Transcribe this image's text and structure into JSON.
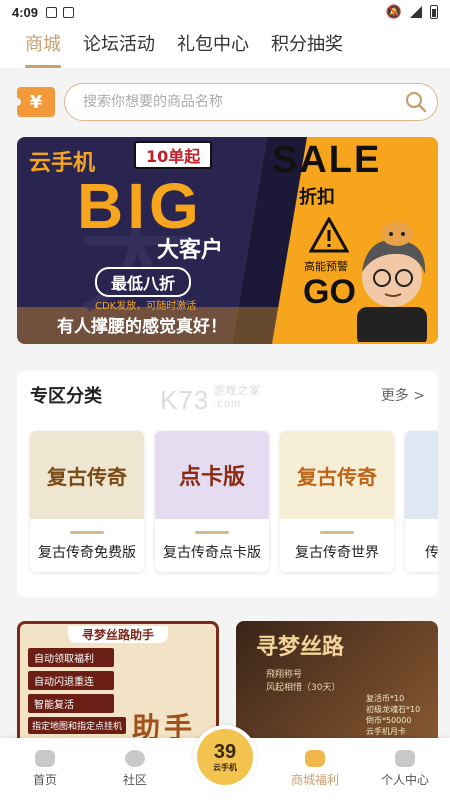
{
  "status": {
    "time": "4:09"
  },
  "tabs": [
    {
      "label": "商城",
      "active": true
    },
    {
      "label": "论坛活动",
      "active": false
    },
    {
      "label": "礼包中心",
      "active": false
    },
    {
      "label": "积分抽奖",
      "active": false
    }
  ],
  "search": {
    "badge": "¥",
    "placeholder": "搜索你想要的商品名称"
  },
  "banner": {
    "brand": "云手机",
    "tag": "10单起",
    "big": "BIG",
    "big_sub": "大客户",
    "discount": "最低八折",
    "cdk": "CDK发放，可随时激活",
    "slogan": "有人撑腰的感觉真好！",
    "sale": "SALE",
    "sale_sub": "折扣",
    "warn": "高能预警",
    "go": "GO"
  },
  "zone": {
    "title": "专区分类",
    "more": "更多 >",
    "watermark": "K73",
    "watermark_cn": "游戏之家",
    "watermark_url": ".com",
    "items": [
      {
        "name": "复古传奇免费版",
        "logo": "复古传奇",
        "color": "#efe6d2"
      },
      {
        "name": "复古传奇点卡版",
        "logo": "点卡版",
        "color": "#e6dcf2"
      },
      {
        "name": "复古传奇世界",
        "logo": "复古传奇",
        "color": "#f6efd6"
      },
      {
        "name": "传",
        "logo": "",
        "color": "#dfe9f3"
      }
    ]
  },
  "posters": {
    "left_title": "寻梦丝路助手",
    "left_items": [
      "自动领取福利",
      "自动闪退重连",
      "智能复活",
      "指定地图和指定点挂机"
    ],
    "left_big": "助手",
    "right_title": "寻梦丝路",
    "right_lines": [
      "飛翔称号",
      "风起相惜（30天）",
      "复活币*10",
      "初级龙魂石*10",
      "倒币*50000",
      "云手机月卡"
    ]
  },
  "nav": [
    {
      "label": "首页",
      "active": false
    },
    {
      "label": "社区",
      "active": false
    },
    {
      "label": "",
      "active": false,
      "center": true
    },
    {
      "label": "商城福利",
      "active": true
    },
    {
      "label": "个人中心",
      "active": false
    }
  ],
  "center": {
    "num": "39",
    "sub": "云手机"
  }
}
